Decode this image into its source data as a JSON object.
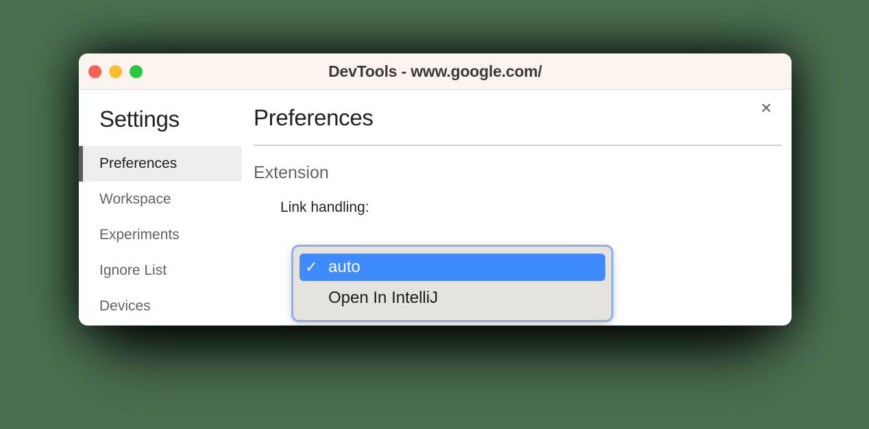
{
  "window": {
    "title": "DevTools - www.google.com/",
    "traffic_lights": [
      {
        "name": "close",
        "color": "#ff5f56"
      },
      {
        "name": "minimize",
        "color": "#febc2e"
      },
      {
        "name": "maximize",
        "color": "#28c840"
      }
    ],
    "close_icon": "✕"
  },
  "sidebar": {
    "title": "Settings",
    "items": [
      {
        "label": "Preferences",
        "selected": true
      },
      {
        "label": "Workspace",
        "selected": false
      },
      {
        "label": "Experiments",
        "selected": false
      },
      {
        "label": "Ignore List",
        "selected": false
      },
      {
        "label": "Devices",
        "selected": false
      }
    ]
  },
  "main": {
    "page_title": "Preferences",
    "section_title": "Extension",
    "field_label": "Link handling:"
  },
  "select_popup": {
    "selected_value": "auto",
    "check_glyph": "✓",
    "options": [
      {
        "label": "auto",
        "checked": true
      },
      {
        "label": "Open In IntelliJ",
        "checked": false
      }
    ]
  },
  "colors": {
    "desktop_background": "#4a6e50",
    "titlebar": "#fbf3ed",
    "accent_blue": "#3d8bfd",
    "selected_nav_background": "#eeeeee",
    "selected_nav_bar": "#5a5a5a"
  }
}
